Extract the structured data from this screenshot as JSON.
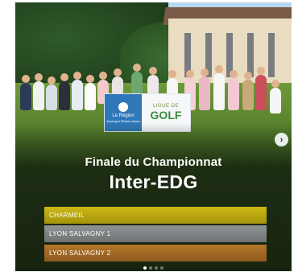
{
  "slide": {
    "subtitle": "Finale du Championnat",
    "title": "Inter-EDG",
    "banner": {
      "left_lines": [
        "Le Région",
        "Auvergne-Rhône-Alpes"
      ],
      "ligue": "LIGUE DE",
      "golf": "GOLF"
    }
  },
  "rankings": [
    {
      "label": "CHARMEIL",
      "color": "#c2ad12"
    },
    {
      "label": "LYON SALVAGNY 1",
      "color": "#858889"
    },
    {
      "label": "LYON SALVAGNY 2",
      "color": "#a86e26"
    }
  ],
  "carousel": {
    "next_icon": "chevron-right-icon",
    "dots": 4,
    "active_dot": 0
  }
}
